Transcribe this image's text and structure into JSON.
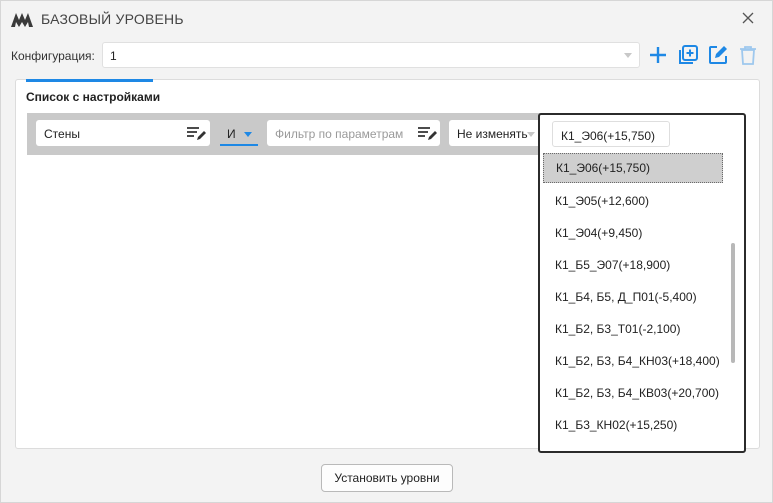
{
  "window": {
    "title": "БАЗОВЫЙ УРОВЕНЬ",
    "logo_icon": "logo-icon",
    "close_icon": "close-icon"
  },
  "config": {
    "label": "Конфигурация:",
    "value": "1",
    "accent": "#1e88e5"
  },
  "toolbar": {
    "icons": [
      "plus-icon",
      "add-copy-icon",
      "edit-icon",
      "delete-icon"
    ]
  },
  "panel": {
    "title": "Список с настройками"
  },
  "filter": {
    "category": "Стены",
    "logic": "И",
    "param_placeholder": "Фильтр по параметрам",
    "action": "Не изменять"
  },
  "dropdown": {
    "search_value": "К1_Э06(+15,750)",
    "selected_index": 0,
    "items": [
      "К1_Э06(+15,750)",
      "К1_Э05(+12,600)",
      "К1_Э04(+9,450)",
      "К1_Б5_Э07(+18,900)",
      "К1_Б4, Б5, Д_П01(-5,400)",
      "К1_Б2, Б3_Т01(-2,100)",
      "К1_Б2, Б3, Б4_КН03(+18,400)",
      "К1_Б2, Б3, Б4_КВ03(+20,700)",
      "К1_Б3_КН02(+15,250)"
    ]
  },
  "footer": {
    "set_levels_label": "Установить уровни"
  }
}
